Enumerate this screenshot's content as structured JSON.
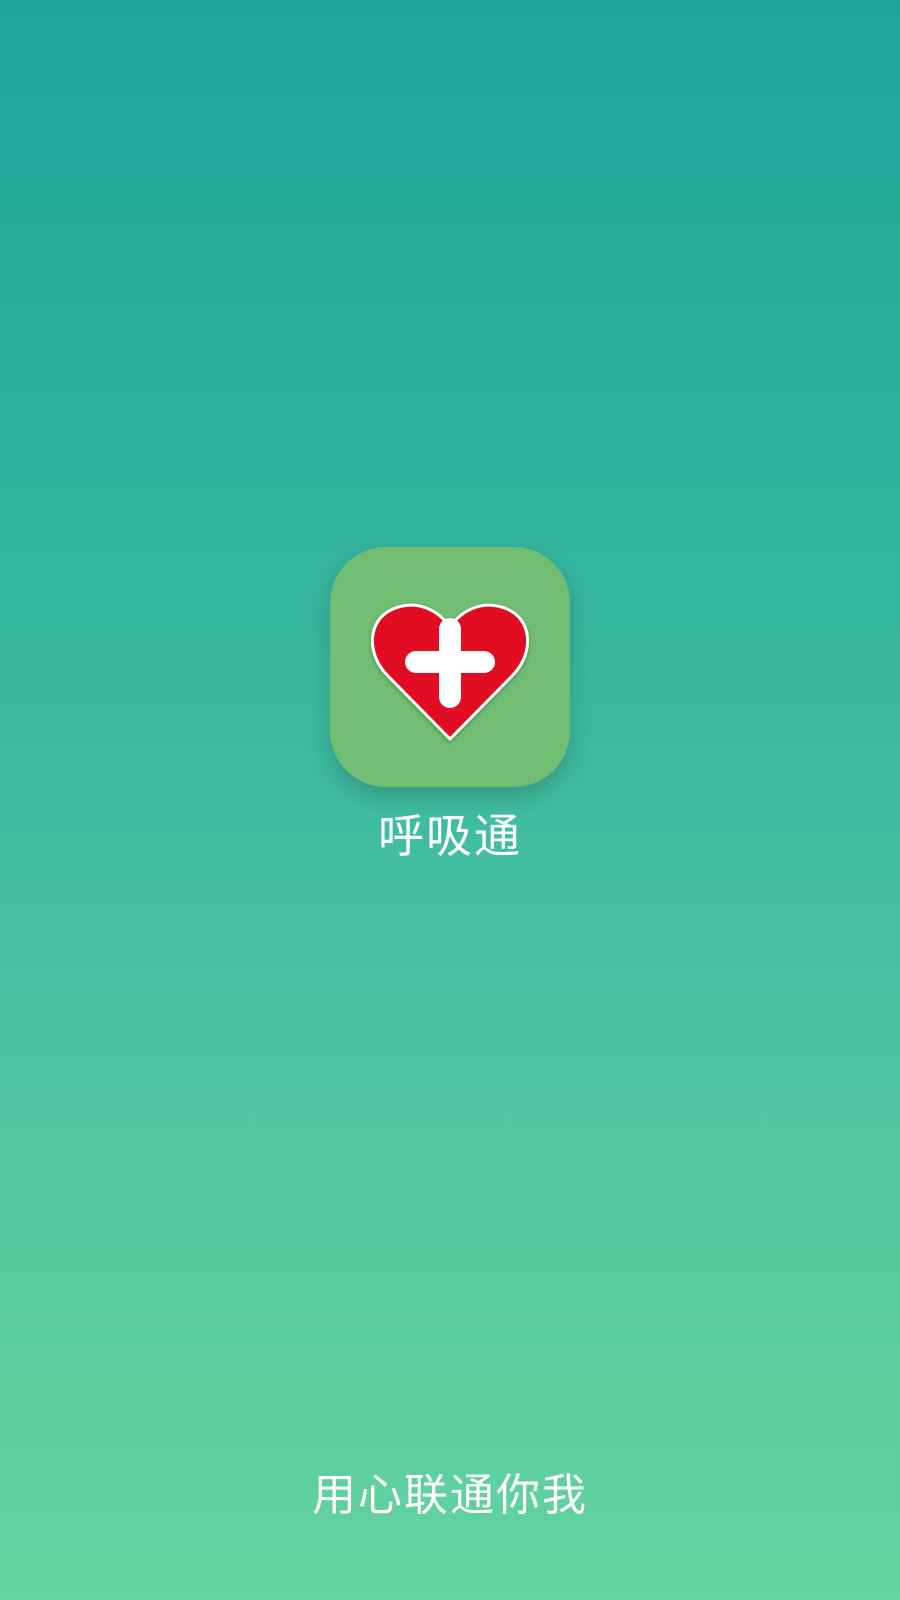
{
  "app": {
    "name": "呼吸通",
    "slogan": "用心联通你我",
    "icon": {
      "name": "heart-plus-icon",
      "background_color": "#70bd73",
      "heart_color": "#e20b22",
      "cross_color": "#ffffff"
    }
  },
  "theme": {
    "gradient_top": "#20a598",
    "gradient_bottom": "#63d39f",
    "text_color": "#ffffff"
  }
}
